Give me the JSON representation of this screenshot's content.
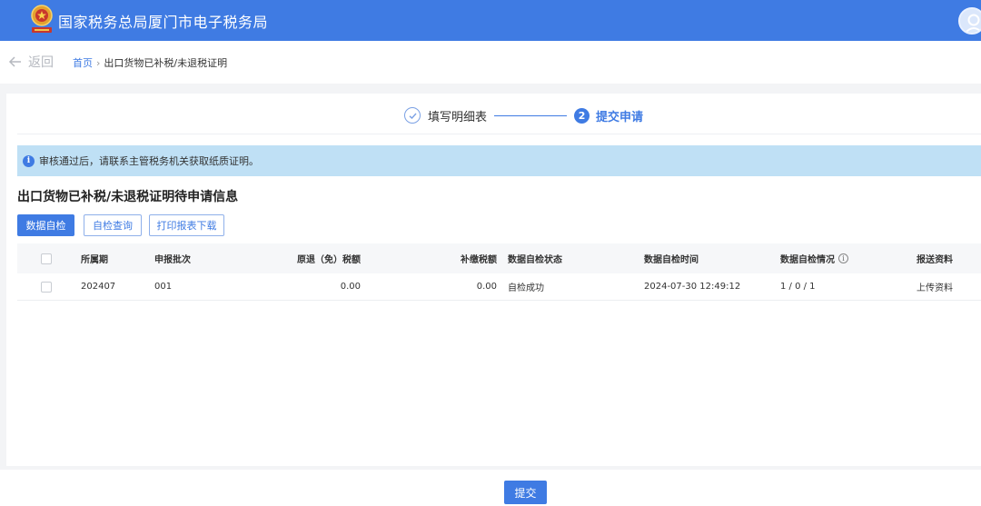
{
  "header": {
    "title": "国家税务总局厦门市电子税务局"
  },
  "breadcrumb": {
    "back_label": "返回",
    "home": "首页",
    "separator": "›",
    "current": "出口货物已补税/未退税证明"
  },
  "steps": [
    {
      "label": "填写明细表",
      "state": "done"
    },
    {
      "label": "提交申请",
      "number": "2",
      "state": "active"
    }
  ],
  "info_message": "审核通过后，请联系主管税务机关获取纸质证明。",
  "section_title": "出口货物已补税/未退税证明待申请信息",
  "actions": {
    "self_check": "数据自检",
    "self_check_query": "自检查询",
    "print_download": "打印报表下载"
  },
  "table": {
    "columns": [
      "所属期",
      "申报批次",
      "原退（免）税额",
      "补缴税额",
      "数据自检状态",
      "数据自检时间",
      "数据自检情况",
      "报送资料"
    ],
    "rows": [
      {
        "period": "202407",
        "batch": "001",
        "original_refund": "0.00",
        "supplementary_tax": "0.00",
        "check_status": "自检成功",
        "check_time": "2024-07-30 12:49:12",
        "check_result": "1 / 0 / 1",
        "materials": "上传资料"
      }
    ]
  },
  "footer": {
    "submit_label": "提交"
  },
  "colors": {
    "brand_blue": "#3f7be3",
    "info_bg": "#bfe0f5"
  }
}
